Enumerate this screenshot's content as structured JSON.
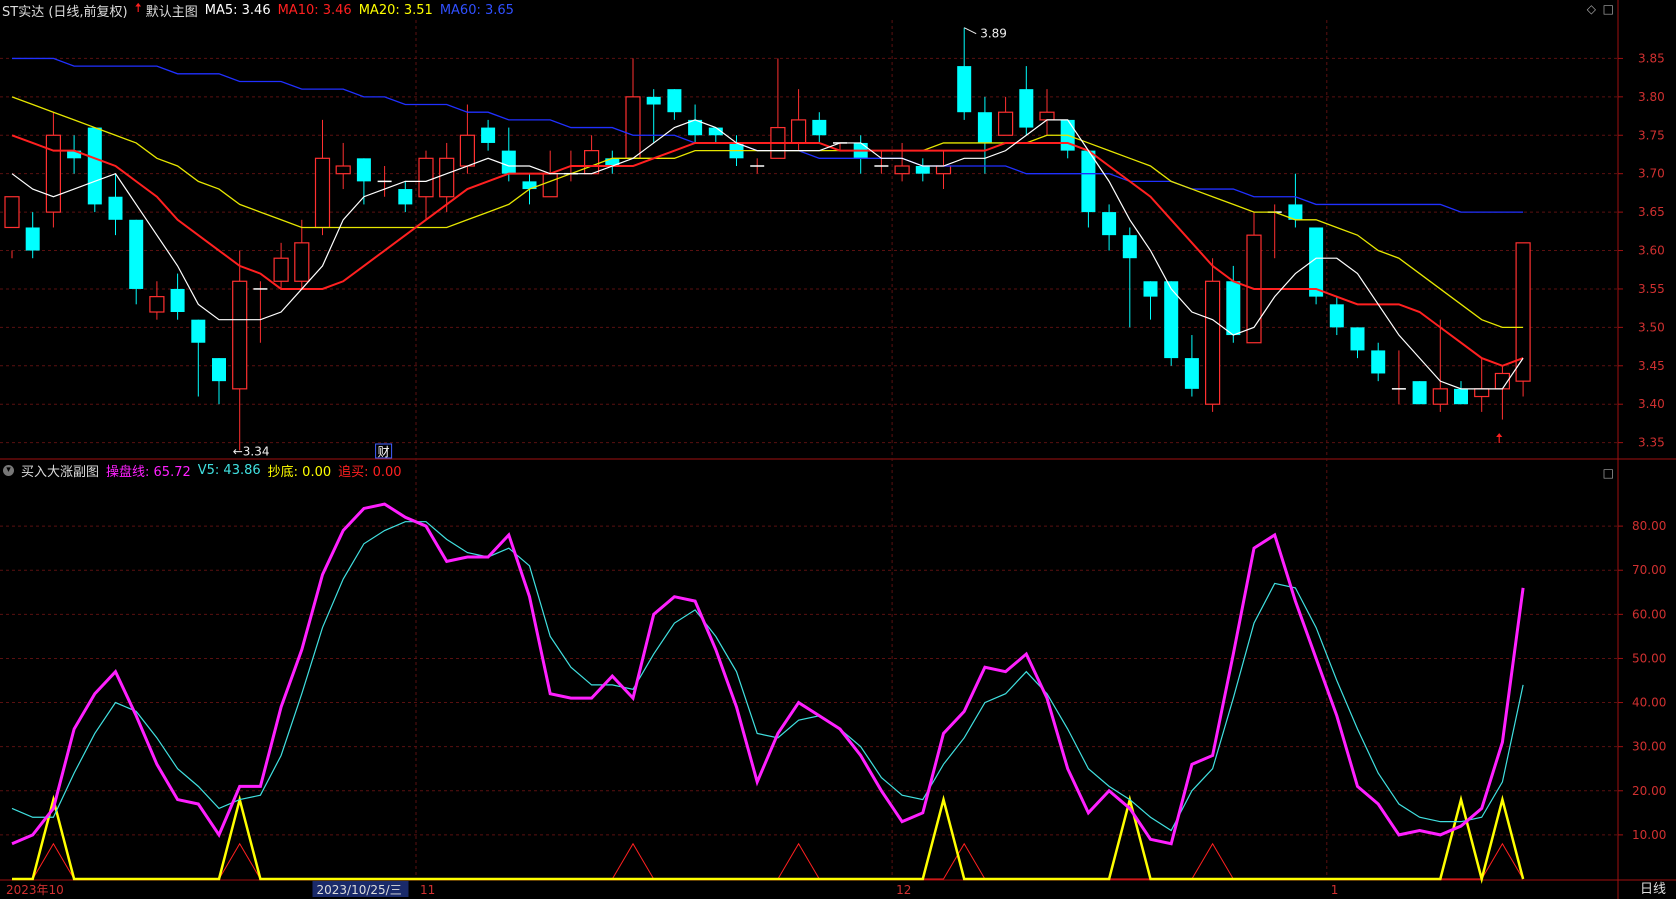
{
  "main_header": {
    "title": "ST实达 (日线,前复权)",
    "arrow_icon": "red-up-arrow-icon",
    "chart_name": "默认主图",
    "ma5": "MA5: 3.46",
    "ma10": "MA10: 3.46",
    "ma20": "MA20: 3.51",
    "ma60": "MA60: 3.65",
    "colors": {
      "ma5": "#ffffff",
      "ma10": "#ff2020",
      "ma20": "#ffff00",
      "ma60": "#3030ff"
    }
  },
  "sub_header": {
    "title": "买入大涨副图",
    "line1": "操盘线: 65.72",
    "line2": "V5: 43.86",
    "line3": "抄底: 0.00",
    "line4": "追买: 0.00",
    "colors": {
      "line1": "#ff20ff",
      "line2": "#40e0e0",
      "line3": "#ffff00",
      "line4": "#ff2020"
    }
  },
  "corner_icons": {
    "diamond": "◇",
    "square": "□"
  },
  "period_label": "日线",
  "main_axis_labels": [
    "3.85",
    "3.80",
    "3.75",
    "3.70",
    "3.65",
    "3.60",
    "3.55",
    "3.50",
    "3.45",
    "3.40",
    "3.35"
  ],
  "sub_axis_labels": [
    "80.00",
    "70.00",
    "60.00",
    "50.00",
    "40.00",
    "30.00",
    "20.00",
    "10.00"
  ],
  "date_labels": [
    {
      "text": "2023年10",
      "idx": 0
    },
    {
      "text": "2023/10/25/三",
      "idx": 15,
      "highlight": true
    },
    {
      "text": "11",
      "idx": 20
    },
    {
      "text": "12",
      "idx": 43
    },
    {
      "text": "1",
      "idx": 64
    }
  ],
  "annotations": {
    "high": "3.89",
    "low": "3.34",
    "fin_icon": "财"
  },
  "chart_data": {
    "type": "candlestick",
    "candles": [
      [
        3.63,
        3.67,
        3.6,
        3.59
      ],
      [
        3.63,
        3.6,
        3.65,
        3.59
      ],
      [
        3.65,
        3.75,
        3.78,
        3.63
      ],
      [
        3.73,
        3.72,
        3.75,
        3.7
      ],
      [
        3.76,
        3.66,
        3.76,
        3.65
      ],
      [
        3.67,
        3.64,
        3.7,
        3.62
      ],
      [
        3.64,
        3.55,
        3.64,
        3.53
      ],
      [
        3.52,
        3.54,
        3.56,
        3.51
      ],
      [
        3.55,
        3.52,
        3.57,
        3.51
      ],
      [
        3.51,
        3.48,
        3.51,
        3.41
      ],
      [
        3.46,
        3.43,
        3.46,
        3.4
      ],
      [
        3.42,
        3.56,
        3.6,
        3.34
      ],
      [
        3.55,
        3.55,
        3.56,
        3.48
      ],
      [
        3.56,
        3.59,
        3.61,
        3.55
      ],
      [
        3.56,
        3.61,
        3.64,
        3.55
      ],
      [
        3.63,
        3.72,
        3.77,
        3.62
      ],
      [
        3.7,
        3.71,
        3.74,
        3.68
      ],
      [
        3.72,
        3.69,
        3.72,
        3.66
      ],
      [
        3.69,
        3.69,
        3.71,
        3.67
      ],
      [
        3.68,
        3.66,
        3.69,
        3.65
      ],
      [
        3.67,
        3.72,
        3.73,
        3.64
      ],
      [
        3.67,
        3.72,
        3.74,
        3.65
      ],
      [
        3.71,
        3.75,
        3.79,
        3.7
      ],
      [
        3.76,
        3.74,
        3.77,
        3.73
      ],
      [
        3.73,
        3.7,
        3.76,
        3.69
      ],
      [
        3.69,
        3.68,
        3.7,
        3.66
      ],
      [
        3.67,
        3.7,
        3.73,
        3.67
      ],
      [
        3.7,
        3.7,
        3.73,
        3.69
      ],
      [
        3.7,
        3.73,
        3.75,
        3.7
      ],
      [
        3.72,
        3.71,
        3.73,
        3.7
      ],
      [
        3.72,
        3.8,
        3.85,
        3.72
      ],
      [
        3.8,
        3.79,
        3.81,
        3.74
      ],
      [
        3.81,
        3.78,
        3.81,
        3.77
      ],
      [
        3.77,
        3.75,
        3.79,
        3.74
      ],
      [
        3.76,
        3.75,
        3.76,
        3.74
      ],
      [
        3.74,
        3.72,
        3.75,
        3.71
      ],
      [
        3.71,
        3.71,
        3.72,
        3.7
      ],
      [
        3.72,
        3.76,
        3.85,
        3.72
      ],
      [
        3.74,
        3.77,
        3.81,
        3.73
      ],
      [
        3.77,
        3.75,
        3.78,
        3.74
      ],
      [
        3.74,
        3.74,
        3.74,
        3.73
      ],
      [
        3.74,
        3.72,
        3.75,
        3.7
      ],
      [
        3.71,
        3.71,
        3.73,
        3.7
      ],
      [
        3.7,
        3.71,
        3.74,
        3.69
      ],
      [
        3.71,
        3.7,
        3.72,
        3.69
      ],
      [
        3.7,
        3.71,
        3.73,
        3.68
      ],
      [
        3.84,
        3.78,
        3.89,
        3.77
      ],
      [
        3.78,
        3.74,
        3.8,
        3.7
      ],
      [
        3.75,
        3.78,
        3.8,
        3.75
      ],
      [
        3.81,
        3.76,
        3.84,
        3.75
      ],
      [
        3.77,
        3.78,
        3.81,
        3.75
      ],
      [
        3.77,
        3.73,
        3.77,
        3.72
      ],
      [
        3.73,
        3.65,
        3.73,
        3.63
      ],
      [
        3.65,
        3.62,
        3.66,
        3.6
      ],
      [
        3.62,
        3.59,
        3.63,
        3.5
      ],
      [
        3.56,
        3.54,
        3.56,
        3.51
      ],
      [
        3.56,
        3.46,
        3.56,
        3.45
      ],
      [
        3.46,
        3.42,
        3.49,
        3.41
      ],
      [
        3.4,
        3.56,
        3.59,
        3.39
      ],
      [
        3.56,
        3.49,
        3.58,
        3.48
      ],
      [
        3.48,
        3.62,
        3.65,
        3.48
      ],
      [
        3.65,
        3.65,
        3.66,
        3.59
      ],
      [
        3.66,
        3.64,
        3.7,
        3.63
      ],
      [
        3.63,
        3.54,
        3.63,
        3.53
      ],
      [
        3.53,
        3.5,
        3.54,
        3.49
      ],
      [
        3.5,
        3.47,
        3.5,
        3.46
      ],
      [
        3.47,
        3.44,
        3.48,
        3.43
      ],
      [
        3.42,
        3.42,
        3.47,
        3.4
      ],
      [
        3.43,
        3.4,
        3.43,
        3.4
      ],
      [
        3.4,
        3.42,
        3.51,
        3.39
      ],
      [
        3.42,
        3.4,
        3.43,
        3.4
      ],
      [
        3.41,
        3.42,
        3.46,
        3.39
      ],
      [
        3.42,
        3.44,
        3.45,
        3.38
      ],
      [
        3.43,
        3.61,
        3.61,
        3.41
      ]
    ],
    "ma5": [
      3.7,
      3.68,
      3.67,
      3.68,
      3.69,
      3.7,
      3.66,
      3.62,
      3.58,
      3.53,
      3.51,
      3.51,
      3.51,
      3.52,
      3.55,
      3.58,
      3.64,
      3.67,
      3.68,
      3.69,
      3.69,
      3.7,
      3.71,
      3.72,
      3.71,
      3.71,
      3.7,
      3.7,
      3.7,
      3.71,
      3.72,
      3.74,
      3.76,
      3.77,
      3.76,
      3.74,
      3.73,
      3.73,
      3.73,
      3.73,
      3.74,
      3.74,
      3.72,
      3.72,
      3.71,
      3.71,
      3.72,
      3.72,
      3.73,
      3.75,
      3.77,
      3.77,
      3.73,
      3.69,
      3.64,
      3.6,
      3.55,
      3.52,
      3.51,
      3.49,
      3.5,
      3.54,
      3.57,
      3.59,
      3.59,
      3.57,
      3.53,
      3.49,
      3.46,
      3.43,
      3.42,
      3.42,
      3.42,
      3.46
    ],
    "ma10": [
      3.75,
      3.74,
      3.73,
      3.73,
      3.72,
      3.71,
      3.69,
      3.67,
      3.64,
      3.62,
      3.6,
      3.58,
      3.57,
      3.55,
      3.55,
      3.55,
      3.56,
      3.58,
      3.6,
      3.62,
      3.64,
      3.66,
      3.68,
      3.69,
      3.7,
      3.7,
      3.7,
      3.71,
      3.71,
      3.71,
      3.71,
      3.72,
      3.73,
      3.74,
      3.74,
      3.74,
      3.74,
      3.74,
      3.74,
      3.74,
      3.73,
      3.73,
      3.73,
      3.73,
      3.73,
      3.73,
      3.73,
      3.73,
      3.74,
      3.74,
      3.74,
      3.74,
      3.73,
      3.71,
      3.69,
      3.67,
      3.64,
      3.61,
      3.58,
      3.56,
      3.55,
      3.55,
      3.55,
      3.55,
      3.54,
      3.53,
      3.53,
      3.53,
      3.52,
      3.5,
      3.48,
      3.46,
      3.45,
      3.46
    ],
    "ma20": [
      3.8,
      3.79,
      3.78,
      3.77,
      3.76,
      3.75,
      3.74,
      3.72,
      3.71,
      3.69,
      3.68,
      3.66,
      3.65,
      3.64,
      3.63,
      3.63,
      3.63,
      3.63,
      3.63,
      3.63,
      3.63,
      3.63,
      3.64,
      3.65,
      3.66,
      3.68,
      3.69,
      3.7,
      3.71,
      3.72,
      3.72,
      3.72,
      3.72,
      3.73,
      3.73,
      3.73,
      3.73,
      3.73,
      3.73,
      3.73,
      3.73,
      3.73,
      3.73,
      3.73,
      3.73,
      3.74,
      3.74,
      3.74,
      3.74,
      3.74,
      3.75,
      3.75,
      3.74,
      3.73,
      3.72,
      3.71,
      3.69,
      3.68,
      3.67,
      3.66,
      3.65,
      3.65,
      3.64,
      3.64,
      3.63,
      3.62,
      3.6,
      3.59,
      3.57,
      3.55,
      3.53,
      3.51,
      3.5,
      3.5
    ],
    "ma60": [
      3.85,
      3.85,
      3.85,
      3.84,
      3.84,
      3.84,
      3.84,
      3.84,
      3.83,
      3.83,
      3.83,
      3.82,
      3.82,
      3.82,
      3.81,
      3.81,
      3.81,
      3.8,
      3.8,
      3.79,
      3.79,
      3.79,
      3.78,
      3.78,
      3.77,
      3.77,
      3.77,
      3.76,
      3.76,
      3.76,
      3.75,
      3.75,
      3.75,
      3.74,
      3.74,
      3.74,
      3.73,
      3.73,
      3.73,
      3.72,
      3.72,
      3.72,
      3.72,
      3.72,
      3.71,
      3.71,
      3.71,
      3.71,
      3.71,
      3.7,
      3.7,
      3.7,
      3.7,
      3.7,
      3.69,
      3.69,
      3.69,
      3.68,
      3.68,
      3.68,
      3.67,
      3.67,
      3.67,
      3.66,
      3.66,
      3.66,
      3.66,
      3.66,
      3.66,
      3.66,
      3.65,
      3.65,
      3.65,
      3.65
    ],
    "cp_line": [
      8,
      10,
      16,
      34,
      42,
      47,
      37,
      26,
      18,
      17,
      10,
      21,
      21,
      39,
      52,
      69,
      79,
      84,
      85,
      82,
      80,
      72,
      73,
      73,
      78,
      64,
      42,
      41,
      41,
      46,
      41,
      60,
      64,
      63,
      52,
      39,
      22,
      33,
      40,
      37,
      34,
      28,
      20,
      13,
      15,
      33,
      38,
      48,
      47,
      51,
      41,
      25,
      15,
      20,
      16,
      9,
      8,
      26,
      28,
      51,
      75,
      78,
      63,
      50,
      37,
      21,
      17,
      10,
      11,
      10,
      12,
      16,
      31,
      66
    ],
    "v5": [
      16,
      14,
      14,
      24,
      33,
      40,
      38,
      32,
      25,
      21,
      16,
      18,
      19,
      28,
      42,
      57,
      68,
      76,
      79,
      81,
      81,
      77,
      74,
      73,
      75,
      71,
      55,
      48,
      44,
      44,
      43,
      51,
      58,
      61,
      55,
      47,
      33,
      32,
      36,
      37,
      34,
      30,
      23,
      19,
      18,
      26,
      32,
      40,
      42,
      47,
      42,
      34,
      25,
      21,
      18,
      14,
      11,
      20,
      25,
      41,
      58,
      67,
      66,
      57,
      45,
      34,
      24,
      17,
      14,
      13,
      13,
      14,
      22,
      44
    ],
    "buy_bottom": [
      0,
      0,
      18,
      0,
      0,
      0,
      0,
      0,
      0,
      0,
      0,
      18,
      0,
      0,
      0,
      0,
      0,
      0,
      0,
      0,
      0,
      0,
      0,
      0,
      0,
      0,
      0,
      0,
      0,
      0,
      0,
      0,
      0,
      0,
      0,
      0,
      0,
      0,
      0,
      0,
      0,
      0,
      0,
      0,
      0,
      18,
      0,
      0,
      0,
      0,
      0,
      0,
      0,
      0,
      18,
      0,
      0,
      0,
      0,
      0,
      0,
      0,
      0,
      0,
      0,
      0,
      0,
      0,
      0,
      0,
      18,
      0,
      18,
      0
    ],
    "chase": [
      0,
      0,
      8,
      0,
      0,
      0,
      0,
      0,
      0,
      0,
      0,
      8,
      0,
      0,
      0,
      0,
      0,
      0,
      0,
      0,
      0,
      0,
      0,
      0,
      0,
      0,
      0,
      0,
      0,
      0,
      8,
      0,
      0,
      0,
      0,
      0,
      0,
      0,
      8,
      0,
      0,
      0,
      0,
      0,
      0,
      0,
      8,
      0,
      0,
      0,
      0,
      0,
      0,
      0,
      0,
      0,
      0,
      0,
      8,
      0,
      0,
      0,
      0,
      0,
      0,
      0,
      0,
      0,
      0,
      0,
      0,
      0,
      8,
      0
    ],
    "main_ylim": [
      3.33,
      3.9
    ],
    "sub_ylim": [
      0,
      90
    ]
  }
}
